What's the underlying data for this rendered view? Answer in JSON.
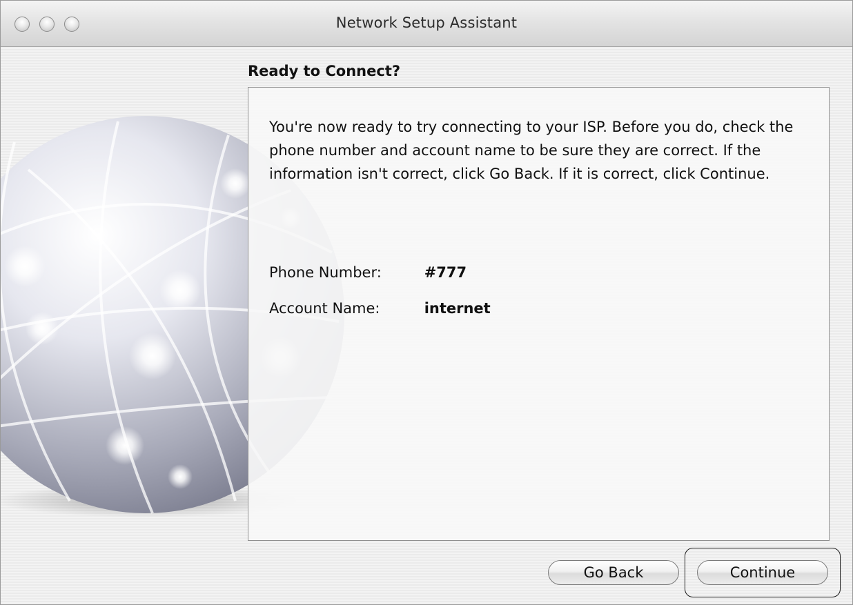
{
  "window": {
    "title": "Network Setup Assistant",
    "controls": [
      "close-button",
      "minimize-button",
      "zoom-button"
    ]
  },
  "page": {
    "heading": "Ready to Connect?",
    "intro": "You're now ready to try connecting to your ISP. Before you do, check the phone number and account name to be sure they are correct. If the information isn't correct, click Go Back. If it is correct, click Continue.",
    "fields": [
      {
        "label": "Phone Number:",
        "value": "#777"
      },
      {
        "label": "Account Name:",
        "value": "internet"
      }
    ]
  },
  "buttons": {
    "go_back": "Go Back",
    "continue": "Continue",
    "default": "continue"
  },
  "colors": {
    "window_bg": "#efefef",
    "content_bg": "#f8f8f8",
    "border": "#8f8f8f"
  }
}
